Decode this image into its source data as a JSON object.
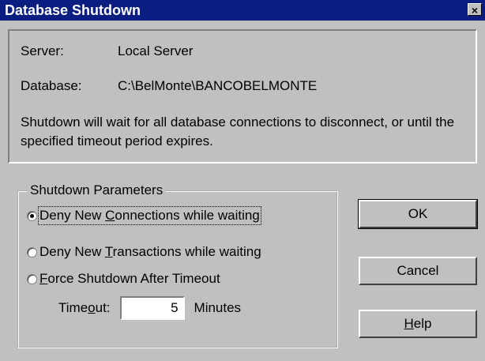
{
  "window": {
    "title": "Database Shutdown",
    "close_label": "×"
  },
  "info": {
    "server_label": "Server:",
    "server_value": "Local Server",
    "database_label": "Database:",
    "database_value": "C:\\BelMonte\\BANCOBELMONTE",
    "message": "Shutdown will wait for all database connections to disconnect, or until the specified timeout period expires."
  },
  "params": {
    "legend": "Shutdown Parameters",
    "options": [
      {
        "pre": "Deny New ",
        "mn": "C",
        "post": "onnections while waiting",
        "checked": true
      },
      {
        "pre": "Deny New ",
        "mn": "T",
        "post": "ransactions while waiting",
        "checked": false
      },
      {
        "pre": "",
        "mn": "F",
        "post": "orce Shutdown After Timeout",
        "checked": false
      }
    ],
    "timeout_pre": "Time",
    "timeout_mn": "o",
    "timeout_post": "ut:",
    "timeout_value": "5",
    "minutes_label": "Minutes"
  },
  "buttons": {
    "ok": "OK",
    "cancel": "Cancel",
    "help_mn": "H",
    "help_post": "elp"
  }
}
